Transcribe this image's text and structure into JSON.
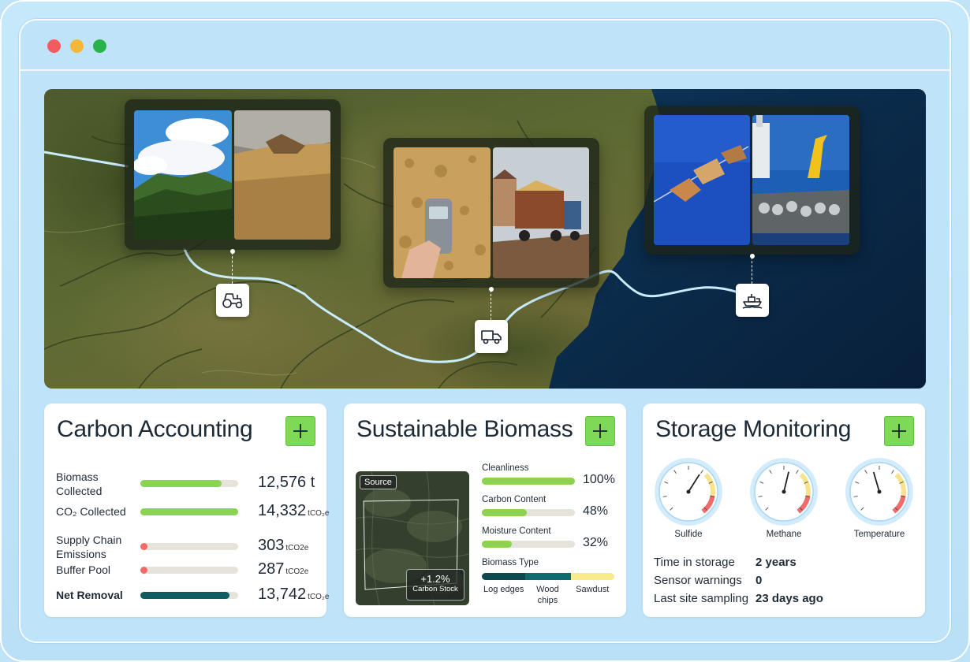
{
  "map": {
    "route_icons": [
      "tractor-icon",
      "truck-icon",
      "ship-icon"
    ]
  },
  "carbon_accounting": {
    "title": "Carbon Accounting",
    "rows": [
      {
        "label": "Biomass Collected",
        "value": "12,576",
        "unit_inline": " t",
        "unit": "",
        "fill": 0.83,
        "color": "#8cd34f",
        "bold": false
      },
      {
        "label": "CO₂ Collected",
        "value": "14,332",
        "unit_inline": "",
        "unit": "tCO₂e",
        "fill": 1.0,
        "color": "#8cd34f",
        "bold": false
      },
      {
        "label": "Supply Chain Emissions",
        "value": "303",
        "unit_inline": "",
        "unit": "tCO2e",
        "fill": 0.07,
        "color": "#f26b6b",
        "bold": false
      },
      {
        "label": "Buffer Pool",
        "value": "287",
        "unit_inline": "",
        "unit": "tCO2e",
        "fill": 0.06,
        "color": "#f26b6b",
        "bold": false
      },
      {
        "label": "Net Removal",
        "value": "13,742",
        "unit_inline": "",
        "unit": "tCO₂e",
        "fill": 0.91,
        "color": "#0f5d60",
        "bold": true
      }
    ]
  },
  "sustainable_biomass": {
    "title": "Sustainable Biomass",
    "source_tag": "Source",
    "stock_value": "+1.2%",
    "stock_label": "Carbon Stock",
    "metrics": [
      {
        "label": "Cleanliness",
        "value": "100%",
        "fill": 1.0
      },
      {
        "label": "Carbon Content",
        "value": "48%",
        "fill": 0.48
      },
      {
        "label": "Moisture Content",
        "value": "32%",
        "fill": 0.32
      }
    ],
    "biomass_type": {
      "label": "Biomass Type",
      "segments": [
        {
          "name": "Log edges",
          "share": 0.33,
          "color": "#0d4a4e"
        },
        {
          "name": "Wood chips",
          "share": 0.34,
          "color": "#0f6b6e"
        },
        {
          "name": "Sawdust",
          "share": 0.33,
          "color": "#f7ec8a"
        }
      ]
    }
  },
  "storage_monitoring": {
    "title": "Storage Monitoring",
    "gauges": [
      {
        "label": "Sulfide",
        "level": 0.62
      },
      {
        "label": "Methane",
        "level": 0.55
      },
      {
        "label": "Temperature",
        "level": 0.44
      }
    ],
    "stats": [
      {
        "key": "Time in storage",
        "value": "2 years"
      },
      {
        "key": "Sensor warnings",
        "value": "0"
      },
      {
        "key": "Last site sampling",
        "value": "23 days ago"
      }
    ]
  },
  "colors": {
    "accent_green": "#7ed957",
    "bar_green": "#8cd34f",
    "bar_red": "#f26b6b",
    "bar_teal": "#0f5d60",
    "ocean": "#0b2d4e"
  }
}
